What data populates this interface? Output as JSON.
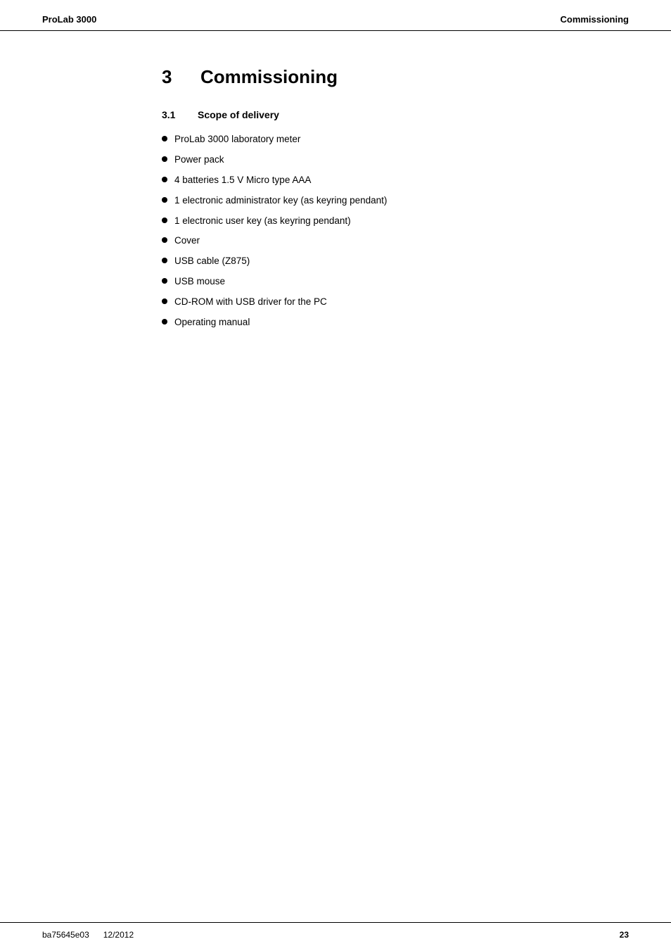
{
  "header": {
    "left": "ProLab 3000",
    "right": "Commissioning"
  },
  "chapter": {
    "number": "3",
    "title": "Commissioning"
  },
  "section": {
    "number": "3.1",
    "title": "Scope of delivery"
  },
  "bullet_items": [
    "ProLab 3000 laboratory meter",
    "Power pack",
    "4 batteries 1.5 V Micro type AAA",
    "1 electronic administrator key (as keyring pendant)",
    "1 electronic user key (as keyring pendant)",
    "Cover",
    "USB cable (Z875)",
    "USB mouse",
    "CD-ROM with USB driver for the PC",
    "Operating manual"
  ],
  "footer": {
    "doc_id": "ba75645e03",
    "date": "12/2012",
    "page_number": "23"
  }
}
